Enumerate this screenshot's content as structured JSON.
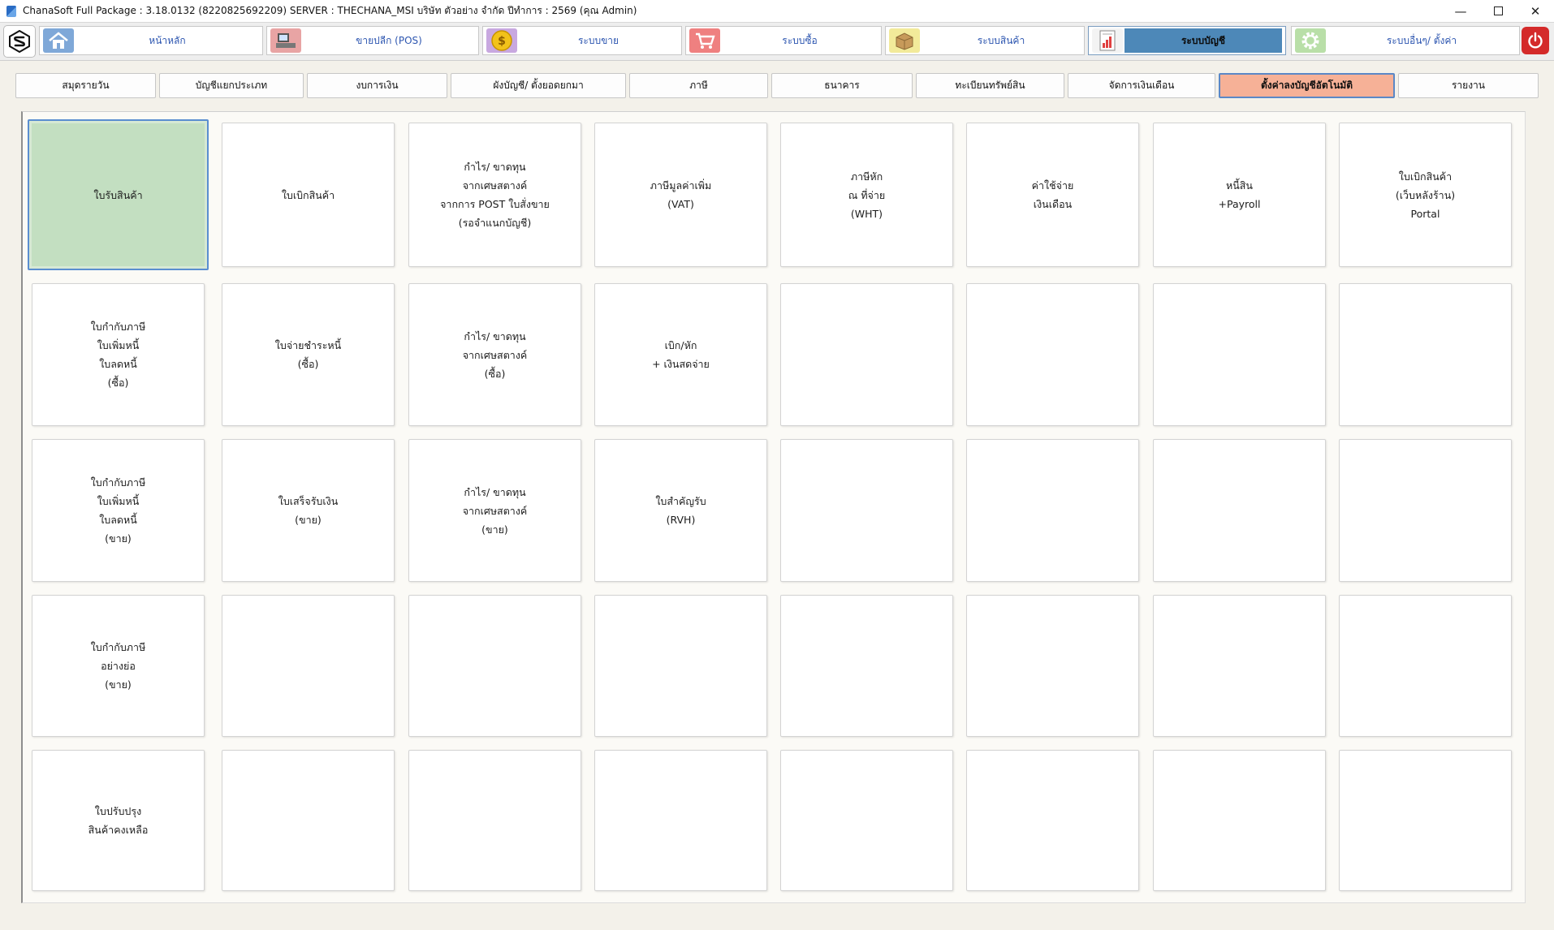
{
  "window": {
    "title": "ChanaSoft Full Package : 3.18.0132 (8220825692209) SERVER : THECHANA_MSI บริษัท ตัวอย่าง จำกัด ปีทำการ : 2569 (คุณ Admin)",
    "minimize_glyph": "—",
    "close_glyph": "✕"
  },
  "nav": {
    "items": [
      {
        "label": "หน้าหลัก",
        "icon": "home-icon"
      },
      {
        "label": "ขายปลีก (POS)",
        "icon": "pos-terminal-icon"
      },
      {
        "label": "ระบบขาย",
        "icon": "coin-icon"
      },
      {
        "label": "ระบบซื้อ",
        "icon": "shopping-cart-icon"
      },
      {
        "label": "ระบบสินค้า",
        "icon": "box-icon"
      },
      {
        "label": "ระบบบัญชี",
        "icon": "ledger-chart-icon"
      },
      {
        "label": "ระบบอื่นๆ/ ตั้งค่า",
        "icon": "gear-icon"
      }
    ],
    "active_index": 5,
    "colors": {
      "accent": "#4d88b8",
      "label": "#2d56b0",
      "power": "#d42a2a"
    }
  },
  "tabs": {
    "items": [
      "สมุดรายวัน",
      "บัญชีแยกประเภท",
      "งบการเงิน",
      "ผังบัญชี/ ตั้งยอดยกมา",
      "ภาษี",
      "ธนาคาร",
      "ทะเบียนทรัพย์สิน",
      "จัดการเงินเดือน",
      "ตั้งค่าลงบัญชีอัตโนมัติ",
      "รายงาน"
    ],
    "active_index": 8,
    "active_color": "#f6b197"
  },
  "grid": {
    "selected_color": "#c3dfc1",
    "cards": [
      "ใบรับสินค้า",
      "ใบเบิกสินค้า",
      "กำไร/ ขาดทุน\nจากเศษสตางค์\nจากการ POST ใบสั่งขาย\n(รอจำแนกบัญชี)",
      "ภาษีมูลค่าเพิ่ม\n(VAT)",
      "ภาษีหัก\nณ ที่จ่าย\n(WHT)",
      "ค่าใช้จ่าย\nเงินเดือน",
      "หนี้สิน\n+Payroll",
      "ใบเบิกสินค้า\n(เว็บหลังร้าน)\nPortal",
      "ใบกำกับภาษี\nใบเพิ่มหนี้\nใบลดหนี้\n(ซื้อ)",
      "ใบจ่ายชำระหนี้\n(ซื้อ)",
      "กำไร/ ขาดทุน\nจากเศษสตางค์\n(ซื้อ)",
      "เบิก/หัก\n+ เงินสดจ่าย",
      "",
      "",
      "",
      "",
      "ใบกำกับภาษี\nใบเพิ่มหนี้\nใบลดหนี้\n(ขาย)",
      "ใบเสร็จรับเงิน\n(ขาย)",
      "กำไร/ ขาดทุน\nจากเศษสตางค์\n(ขาย)",
      "ใบสำคัญรับ\n(RVH)",
      "",
      "",
      "",
      "",
      "ใบกำกับภาษี\nอย่างย่อ\n(ขาย)",
      "",
      "",
      "",
      "",
      "",
      "",
      "",
      "ใบปรับปรุง\nสินค้าคงเหลือ",
      "",
      "",
      "",
      "",
      "",
      "",
      ""
    ],
    "selected_index": 0
  }
}
